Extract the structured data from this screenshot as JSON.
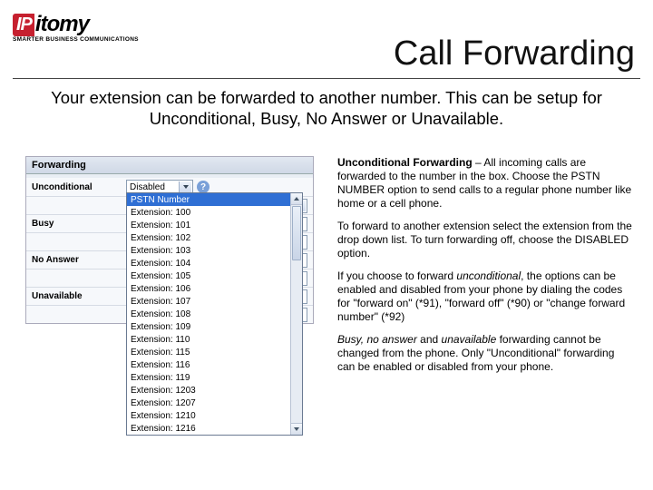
{
  "logo": {
    "brand_a": "IP",
    "brand_b": "itomy",
    "tagline": "SMARTER BUSINESS COMMUNICATIONS"
  },
  "title": "Call Forwarding",
  "intro": "Your extension can be forwarded to another number.  This can be setup for Unconditional, Busy, No Answer or Unavailable.",
  "panel": {
    "header": "Forwarding",
    "rows": {
      "unconditional": "Unconditional",
      "busy": "Busy",
      "noanswer": "No Answer",
      "unavailable": "Unavailable"
    },
    "unc_select_value": "Disabled",
    "unc_text_value": "PSTN Number",
    "help": "?",
    "dropdown": [
      "PSTN Number",
      "Extension: 100",
      "Extension: 101",
      "Extension: 102",
      "Extension: 103",
      "Extension: 104",
      "Extension: 105",
      "Extension: 106",
      "Extension: 107",
      "Extension: 108",
      "Extension: 109",
      "Extension: 110",
      "Extension: 115",
      "Extension: 116",
      "Extension: 119",
      "Extension: 1203",
      "Extension: 1207",
      "Extension: 1210",
      "Extension: 1216"
    ]
  },
  "desc": {
    "p1_b": "Unconditional Forwarding",
    "p1": " – All incoming calls are forwarded to the number in the box.  Choose the PSTN NUMBER option to send calls to a regular phone number like home or a cell phone.",
    "p2": "To forward to another extension select the extension from the drop down list.  To turn forwarding off, choose the DISABLED option.",
    "p3a": "If you choose to forward ",
    "p3i": "unconditional",
    "p3b": ", the options can be enabled and disabled from your phone by dialing the codes for \"forward on\" (*91), \"forward off\" (*90) or \"change forward number\" (*92)",
    "p4i": "Busy, no answer",
    "p4a": " and ",
    "p4i2": "unavailable",
    "p4b": " forwarding cannot be changed from the phone. Only \"Unconditional\" forwarding can be enabled or disabled from your phone."
  }
}
